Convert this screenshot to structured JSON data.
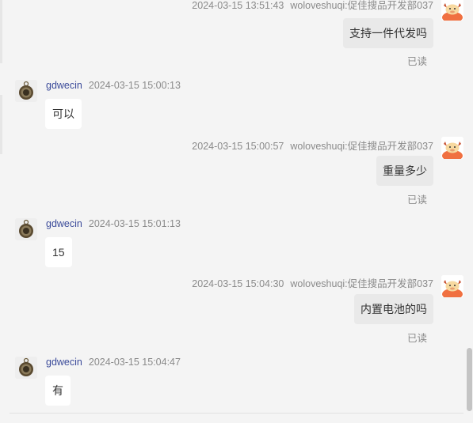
{
  "messages": [
    {
      "side": "right",
      "time": "2024-03-15 13:51:43",
      "sender": "woloveshuqi:促佳搜品开发部037",
      "text": "支持一件代发吗",
      "status": "已读"
    },
    {
      "side": "left",
      "name": "gdwecin",
      "time": "2024-03-15 15:00:13",
      "text": "可以"
    },
    {
      "side": "right",
      "time": "2024-03-15 15:00:57",
      "sender": "woloveshuqi:促佳搜品开发部037",
      "text": "重量多少",
      "status": "已读"
    },
    {
      "side": "left",
      "name": "gdwecin",
      "time": "2024-03-15 15:01:13",
      "text": "15"
    },
    {
      "side": "right",
      "time": "2024-03-15 15:04:30",
      "sender": "woloveshuqi:促佳搜品开发部037",
      "text": "内置电池的吗",
      "status": "已读"
    },
    {
      "side": "left",
      "name": "gdwecin",
      "time": "2024-03-15 15:04:47",
      "text": "有"
    }
  ]
}
